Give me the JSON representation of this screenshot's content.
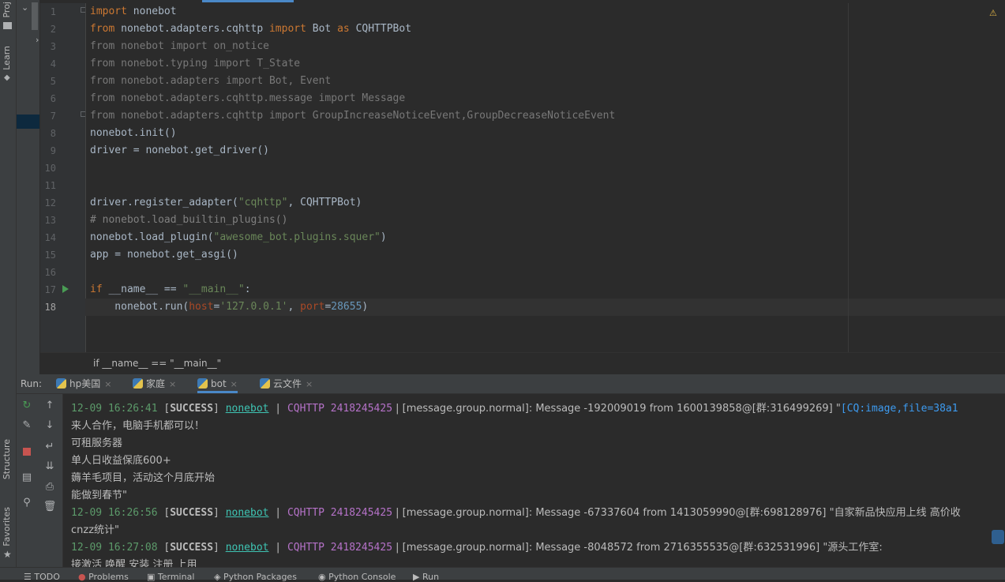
{
  "left_strip": {
    "project": "Proj",
    "learn": "Learn",
    "structure": "Structure",
    "favorites": "Favorites"
  },
  "editor": {
    "warning_badge": "⚠",
    "lines": [
      {
        "n": "1"
      },
      {
        "n": "2"
      },
      {
        "n": "3"
      },
      {
        "n": "4"
      },
      {
        "n": "5"
      },
      {
        "n": "6"
      },
      {
        "n": "7"
      },
      {
        "n": "8"
      },
      {
        "n": "9"
      },
      {
        "n": "10"
      },
      {
        "n": "11"
      },
      {
        "n": "12"
      },
      {
        "n": "13"
      },
      {
        "n": "14"
      },
      {
        "n": "15"
      },
      {
        "n": "16"
      },
      {
        "n": "17"
      },
      {
        "n": "18"
      }
    ],
    "code": {
      "l1_kw": "import",
      "l1_rest": " nonebot",
      "l2_kw1": "from",
      "l2_mid": " nonebot.adapters.cqhttp ",
      "l2_kw2": "import",
      "l2_mid2": " Bot ",
      "l2_kw3": "as",
      "l2_rest": " CQHTTPBot",
      "l3": "from nonebot import on_notice",
      "l4": "from nonebot.typing import T_State",
      "l5": "from nonebot.adapters import Bot, Event",
      "l6": "from nonebot.adapters.cqhttp.message import Message",
      "l7": "from nonebot.adapters.cqhttp import GroupIncreaseNoticeEvent,GroupDecreaseNoticeEvent",
      "l8": "nonebot.init()",
      "l9": "driver = nonebot.get_driver()",
      "l12_a": "driver.register_adapter(",
      "l12_s": "\"cqhttp\"",
      "l12_b": ", CQHTTPBot)",
      "l13": "# nonebot.load_builtin_plugins()",
      "l14_a": "nonebot.load_plugin(",
      "l14_s": "\"awesome_bot.plugins.squer\"",
      "l14_b": ")",
      "l15": "app = nonebot.get_asgi()",
      "l17_kw": "if",
      "l17_a": " __name__ == ",
      "l17_s": "\"__main__\"",
      "l17_b": ":",
      "l18_a": "    nonebot.run(",
      "l18_p1": "host",
      "l18_eq1": "=",
      "l18_s": "'127.0.0.1'",
      "l18_c": ", ",
      "l18_p2": "port",
      "l18_eq2": "=",
      "l18_n": "28655",
      "l18_b": ")"
    }
  },
  "breadcrumb": "if __name__ == \"__main__\"",
  "run": {
    "label": "Run:",
    "tabs": [
      {
        "label": "hp美国"
      },
      {
        "label": "家庭"
      },
      {
        "label": "bot"
      },
      {
        "label": "云文件"
      }
    ],
    "close": "×"
  },
  "console": {
    "lines": [
      {
        "ts": "12-09 16:26:41",
        "status": "SUCCESS",
        "mod": "nonebot",
        "src": "CQHTTP 2418245425",
        "msg": " | [message.group.normal]: Message -192009019 from 1600139858@[群:316499269] \"",
        "link": "[CQ:image,file=38a1"
      },
      {
        "text": "来人合作，电脑手机都可以！"
      },
      {
        "text": "可租服务器"
      },
      {
        "text": "单人日收益保底600+"
      },
      {
        "text": "薅羊毛项目，活动这个月底开始"
      },
      {
        "text": "能做到春节\""
      },
      {
        "ts": "12-09 16:26:56",
        "status": "SUCCESS",
        "mod": "nonebot",
        "src": "CQHTTP 2418245425",
        "msg": " | [message.group.normal]: Message -67337604 from 1413059990@[群:698128976] \"自家新品快应用上线 高价收"
      },
      {
        "text": "cnzz统计\""
      },
      {
        "ts": "12-09 16:27:08",
        "status": "SUCCESS",
        "mod": "nonebot",
        "src": "CQHTTP 2418245425",
        "msg": " | [message.group.normal]: Message -8048572 from 2716355535@[群:632531996] \"源头工作室:"
      },
      {
        "text": "接激活 唤醒 安装 注册 上用"
      }
    ]
  },
  "bottom_bar": {
    "todo": "TODO",
    "problems": "Problems",
    "terminal": "Terminal",
    "packages": "Python Packages",
    "pyconsole": "Python Console",
    "run": "Run"
  },
  "colors": {
    "accent": "#4a88c7",
    "keyword": "#cc7832",
    "string": "#6a8759",
    "number": "#6897bb",
    "module_link": "#3ec4b3",
    "source": "#b572c8"
  }
}
